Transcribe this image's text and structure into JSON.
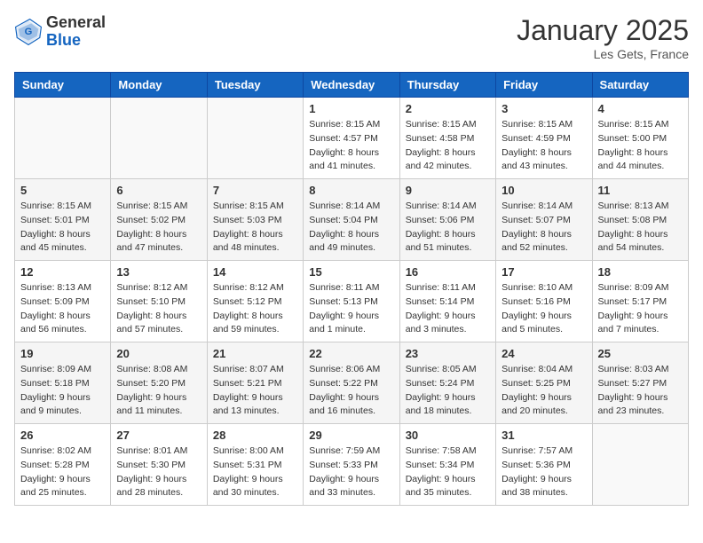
{
  "header": {
    "logo": {
      "line1": "General",
      "line2": "Blue"
    },
    "title": "January 2025",
    "location": "Les Gets, France"
  },
  "days_of_week": [
    "Sunday",
    "Monday",
    "Tuesday",
    "Wednesday",
    "Thursday",
    "Friday",
    "Saturday"
  ],
  "weeks": [
    [
      {
        "day": "",
        "info": ""
      },
      {
        "day": "",
        "info": ""
      },
      {
        "day": "",
        "info": ""
      },
      {
        "day": "1",
        "info": "Sunrise: 8:15 AM\nSunset: 4:57 PM\nDaylight: 8 hours\nand 41 minutes."
      },
      {
        "day": "2",
        "info": "Sunrise: 8:15 AM\nSunset: 4:58 PM\nDaylight: 8 hours\nand 42 minutes."
      },
      {
        "day": "3",
        "info": "Sunrise: 8:15 AM\nSunset: 4:59 PM\nDaylight: 8 hours\nand 43 minutes."
      },
      {
        "day": "4",
        "info": "Sunrise: 8:15 AM\nSunset: 5:00 PM\nDaylight: 8 hours\nand 44 minutes."
      }
    ],
    [
      {
        "day": "5",
        "info": "Sunrise: 8:15 AM\nSunset: 5:01 PM\nDaylight: 8 hours\nand 45 minutes."
      },
      {
        "day": "6",
        "info": "Sunrise: 8:15 AM\nSunset: 5:02 PM\nDaylight: 8 hours\nand 47 minutes."
      },
      {
        "day": "7",
        "info": "Sunrise: 8:15 AM\nSunset: 5:03 PM\nDaylight: 8 hours\nand 48 minutes."
      },
      {
        "day": "8",
        "info": "Sunrise: 8:14 AM\nSunset: 5:04 PM\nDaylight: 8 hours\nand 49 minutes."
      },
      {
        "day": "9",
        "info": "Sunrise: 8:14 AM\nSunset: 5:06 PM\nDaylight: 8 hours\nand 51 minutes."
      },
      {
        "day": "10",
        "info": "Sunrise: 8:14 AM\nSunset: 5:07 PM\nDaylight: 8 hours\nand 52 minutes."
      },
      {
        "day": "11",
        "info": "Sunrise: 8:13 AM\nSunset: 5:08 PM\nDaylight: 8 hours\nand 54 minutes."
      }
    ],
    [
      {
        "day": "12",
        "info": "Sunrise: 8:13 AM\nSunset: 5:09 PM\nDaylight: 8 hours\nand 56 minutes."
      },
      {
        "day": "13",
        "info": "Sunrise: 8:12 AM\nSunset: 5:10 PM\nDaylight: 8 hours\nand 57 minutes."
      },
      {
        "day": "14",
        "info": "Sunrise: 8:12 AM\nSunset: 5:12 PM\nDaylight: 8 hours\nand 59 minutes."
      },
      {
        "day": "15",
        "info": "Sunrise: 8:11 AM\nSunset: 5:13 PM\nDaylight: 9 hours\nand 1 minute."
      },
      {
        "day": "16",
        "info": "Sunrise: 8:11 AM\nSunset: 5:14 PM\nDaylight: 9 hours\nand 3 minutes."
      },
      {
        "day": "17",
        "info": "Sunrise: 8:10 AM\nSunset: 5:16 PM\nDaylight: 9 hours\nand 5 minutes."
      },
      {
        "day": "18",
        "info": "Sunrise: 8:09 AM\nSunset: 5:17 PM\nDaylight: 9 hours\nand 7 minutes."
      }
    ],
    [
      {
        "day": "19",
        "info": "Sunrise: 8:09 AM\nSunset: 5:18 PM\nDaylight: 9 hours\nand 9 minutes."
      },
      {
        "day": "20",
        "info": "Sunrise: 8:08 AM\nSunset: 5:20 PM\nDaylight: 9 hours\nand 11 minutes."
      },
      {
        "day": "21",
        "info": "Sunrise: 8:07 AM\nSunset: 5:21 PM\nDaylight: 9 hours\nand 13 minutes."
      },
      {
        "day": "22",
        "info": "Sunrise: 8:06 AM\nSunset: 5:22 PM\nDaylight: 9 hours\nand 16 minutes."
      },
      {
        "day": "23",
        "info": "Sunrise: 8:05 AM\nSunset: 5:24 PM\nDaylight: 9 hours\nand 18 minutes."
      },
      {
        "day": "24",
        "info": "Sunrise: 8:04 AM\nSunset: 5:25 PM\nDaylight: 9 hours\nand 20 minutes."
      },
      {
        "day": "25",
        "info": "Sunrise: 8:03 AM\nSunset: 5:27 PM\nDaylight: 9 hours\nand 23 minutes."
      }
    ],
    [
      {
        "day": "26",
        "info": "Sunrise: 8:02 AM\nSunset: 5:28 PM\nDaylight: 9 hours\nand 25 minutes."
      },
      {
        "day": "27",
        "info": "Sunrise: 8:01 AM\nSunset: 5:30 PM\nDaylight: 9 hours\nand 28 minutes."
      },
      {
        "day": "28",
        "info": "Sunrise: 8:00 AM\nSunset: 5:31 PM\nDaylight: 9 hours\nand 30 minutes."
      },
      {
        "day": "29",
        "info": "Sunrise: 7:59 AM\nSunset: 5:33 PM\nDaylight: 9 hours\nand 33 minutes."
      },
      {
        "day": "30",
        "info": "Sunrise: 7:58 AM\nSunset: 5:34 PM\nDaylight: 9 hours\nand 35 minutes."
      },
      {
        "day": "31",
        "info": "Sunrise: 7:57 AM\nSunset: 5:36 PM\nDaylight: 9 hours\nand 38 minutes."
      },
      {
        "day": "",
        "info": ""
      }
    ]
  ]
}
